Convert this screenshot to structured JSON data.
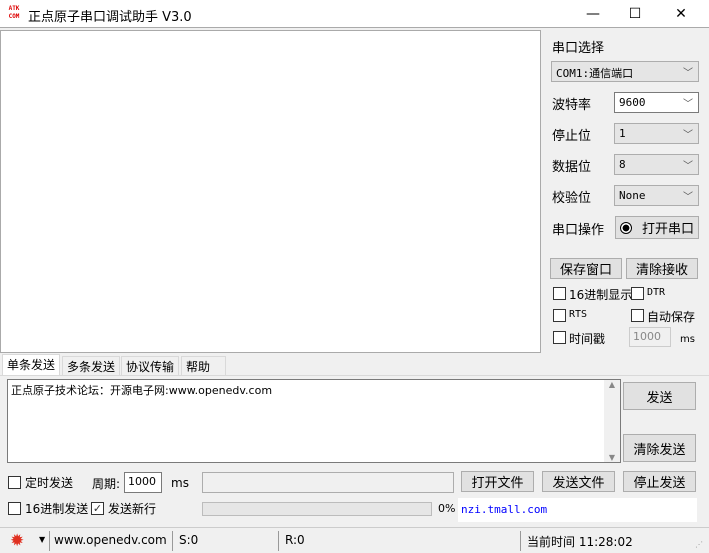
{
  "window": {
    "title": "正点原子串口调试助手 V3.0",
    "logo": "ATK COM",
    "minimize": "—",
    "maximize": "☐",
    "close": "✕"
  },
  "port": {
    "section_label": "串口选择",
    "port_value": "COM1:通信端口",
    "baud_label": "波特率",
    "baud_value": "9600",
    "stop_label": "停止位",
    "stop_value": "1",
    "data_label": "数据位",
    "data_value": "8",
    "parity_label": "校验位",
    "parity_value": "None",
    "op_label": "串口操作",
    "open_button": "打开串口"
  },
  "recv_options": {
    "save_window": "保存窗口",
    "clear_recv": "清除接收",
    "hex_display": "16进制显示",
    "dtr": "DTR",
    "rts": "RTS",
    "auto_save": "自动保存",
    "timestamp": "时间戳",
    "timestamp_ms": "1000",
    "ms": "ms"
  },
  "tabs": [
    "单条发送",
    "多条发送",
    "协议传输",
    "帮助"
  ],
  "send": {
    "text": "正点原子技术论坛：开源电子网:www.openedv.com",
    "send_button": "发送",
    "clear_send": "清除发送",
    "timed_send": "定时发送",
    "period_label": "周期:",
    "period_value": "1000",
    "ms": "ms",
    "open_file": "打开文件",
    "send_file": "发送文件",
    "stop_send": "停止发送",
    "hex_send": "16进制发送",
    "newline": "发送新行",
    "newline_checked": true,
    "progress": "0%",
    "progress_value": 0,
    "marquee": "nzi.tmall.com"
  },
  "status": {
    "website": "www.openedv.com",
    "sent": "S:0",
    "received": "R:0",
    "time": "当前时间 11:28:02"
  },
  "colors": {
    "accent_red": "#e03020",
    "link_blue": "#0000ff"
  }
}
